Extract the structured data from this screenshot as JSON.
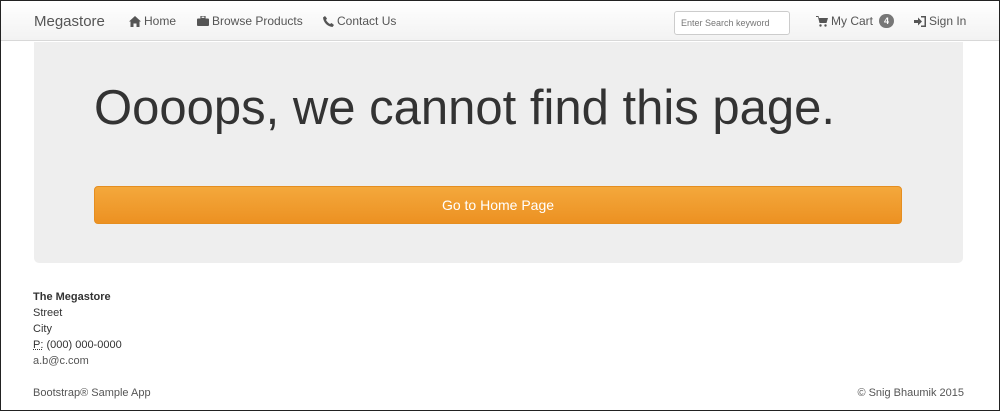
{
  "navbar": {
    "brand": "Megastore",
    "home": "Home",
    "browse": "Browse Products",
    "contact": "Contact Us",
    "search_placeholder": "Enter Search keyword",
    "cart": "My Cart",
    "cart_count": "4",
    "signin": "Sign In"
  },
  "jumbotron": {
    "title": "Oooops, we cannot find this page.",
    "button": "Go to Home Page",
    "button_color": "#ec9122"
  },
  "address": {
    "name": "The Megastore",
    "street": "Street",
    "city": "City",
    "phone_label": "P:",
    "phone": "(000) 000-0000",
    "email": "a.b@c.com"
  },
  "footer": {
    "left": "Bootstrap® Sample App",
    "right": "© Snig Bhaumik 2015"
  }
}
